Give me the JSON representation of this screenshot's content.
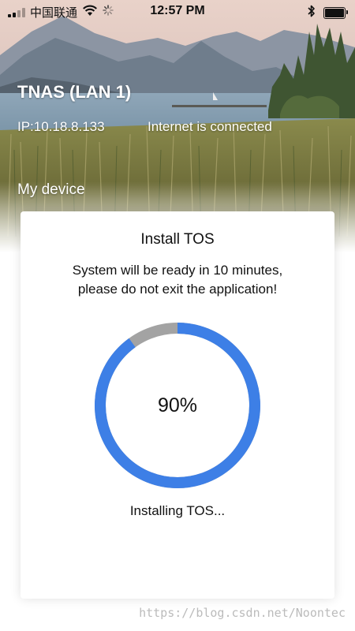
{
  "status_bar": {
    "carrier": "中国联通",
    "time": "12:57 PM",
    "signal_bars": 4,
    "signal_active": 2,
    "battery_level": 1.0
  },
  "device": {
    "name": "TNAS (LAN 1)",
    "ip": "IP:10.18.8.133",
    "network_status": "Internet is connected"
  },
  "section": {
    "label": "My device"
  },
  "modal": {
    "title": "Install TOS",
    "message_line1": "System will be ready in 10 minutes,",
    "message_line2": "please do not exit the application!",
    "progress_value": 0.9,
    "progress_label": "90%",
    "status": "Installing TOS..."
  },
  "colors": {
    "progress_fill": "#3d7fe6",
    "progress_track": "#a3a3a3",
    "modal_bg": "#ffffff"
  },
  "icons": {
    "wifi": "wifi-icon",
    "loading": "loading-spinner-icon",
    "bluetooth": "bluetooth-icon",
    "battery": "battery-icon"
  },
  "watermark": "https://blog.csdn.net/Noontec"
}
